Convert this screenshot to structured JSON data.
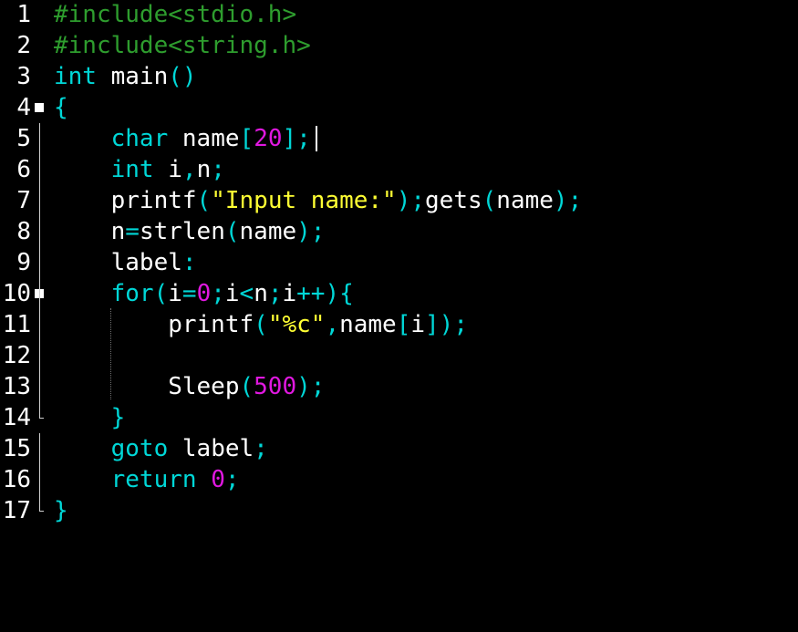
{
  "editor": {
    "colors": {
      "background": "#000000",
      "line_number": "#ffffff",
      "preprocessor": "#2e9d2e",
      "keyword": "#00d7d7",
      "punctuation": "#00d7d7",
      "identifier": "#ffffff",
      "number": "#e018e0",
      "string": "#ffff33"
    },
    "lines": [
      {
        "num": "1",
        "tokens": [
          [
            "dir",
            "#include<stdio.h>"
          ]
        ]
      },
      {
        "num": "2",
        "tokens": [
          [
            "dir",
            "#include<string.h>"
          ]
        ]
      },
      {
        "num": "3",
        "tokens": [
          [
            "kw",
            "int"
          ],
          [
            "id",
            " main"
          ],
          [
            "pun",
            "()"
          ]
        ]
      },
      {
        "num": "4",
        "tokens": [
          [
            "pun",
            "{"
          ]
        ]
      },
      {
        "num": "5",
        "tokens": [
          [
            "id",
            "    "
          ],
          [
            "kw",
            "char"
          ],
          [
            "id",
            " name"
          ],
          [
            "pun",
            "["
          ],
          [
            "num",
            "20"
          ],
          [
            "pun",
            "];"
          ]
        ]
      },
      {
        "num": "6",
        "tokens": [
          [
            "id",
            "    "
          ],
          [
            "kw",
            "int"
          ],
          [
            "id",
            " i"
          ],
          [
            "pun",
            ","
          ],
          [
            "id",
            "n"
          ],
          [
            "pun",
            ";"
          ]
        ]
      },
      {
        "num": "7",
        "tokens": [
          [
            "id",
            "    printf"
          ],
          [
            "pun",
            "("
          ],
          [
            "str",
            "\"Input name:\""
          ],
          [
            "pun",
            ");"
          ],
          [
            "id",
            "gets"
          ],
          [
            "pun",
            "("
          ],
          [
            "id",
            "name"
          ],
          [
            "pun",
            ");"
          ]
        ]
      },
      {
        "num": "8",
        "tokens": [
          [
            "id",
            "    n"
          ],
          [
            "pun",
            "="
          ],
          [
            "id",
            "strlen"
          ],
          [
            "pun",
            "("
          ],
          [
            "id",
            "name"
          ],
          [
            "pun",
            ");"
          ]
        ]
      },
      {
        "num": "9",
        "tokens": [
          [
            "id",
            "    label"
          ],
          [
            "pun",
            ":"
          ]
        ]
      },
      {
        "num": "10",
        "tokens": [
          [
            "id",
            "    "
          ],
          [
            "kw",
            "for"
          ],
          [
            "pun",
            "("
          ],
          [
            "id",
            "i"
          ],
          [
            "pun",
            "="
          ],
          [
            "num",
            "0"
          ],
          [
            "pun",
            ";"
          ],
          [
            "id",
            "i"
          ],
          [
            "pun",
            "<"
          ],
          [
            "id",
            "n"
          ],
          [
            "pun",
            ";"
          ],
          [
            "id",
            "i"
          ],
          [
            "pun",
            "++){"
          ]
        ]
      },
      {
        "num": "11",
        "tokens": [
          [
            "id",
            "        printf"
          ],
          [
            "pun",
            "("
          ],
          [
            "str",
            "\"%c\""
          ],
          [
            "pun",
            ","
          ],
          [
            "id",
            "name"
          ],
          [
            "pun",
            "["
          ],
          [
            "id",
            "i"
          ],
          [
            "pun",
            "]);"
          ]
        ]
      },
      {
        "num": "12",
        "tokens": []
      },
      {
        "num": "13",
        "tokens": [
          [
            "id",
            "        Sleep"
          ],
          [
            "pun",
            "("
          ],
          [
            "num",
            "500"
          ],
          [
            "pun",
            ");"
          ]
        ]
      },
      {
        "num": "14",
        "tokens": [
          [
            "id",
            "    "
          ],
          [
            "pun",
            "}"
          ]
        ]
      },
      {
        "num": "15",
        "tokens": [
          [
            "id",
            "    "
          ],
          [
            "kw",
            "goto"
          ],
          [
            "id",
            " label"
          ],
          [
            "pun",
            ";"
          ]
        ]
      },
      {
        "num": "16",
        "tokens": [
          [
            "id",
            "    "
          ],
          [
            "kw",
            "return"
          ],
          [
            "id",
            " "
          ],
          [
            "num",
            "0"
          ],
          [
            "pun",
            ";"
          ]
        ]
      },
      {
        "num": "17",
        "tokens": [
          [
            "pun",
            "}"
          ]
        ]
      }
    ]
  }
}
